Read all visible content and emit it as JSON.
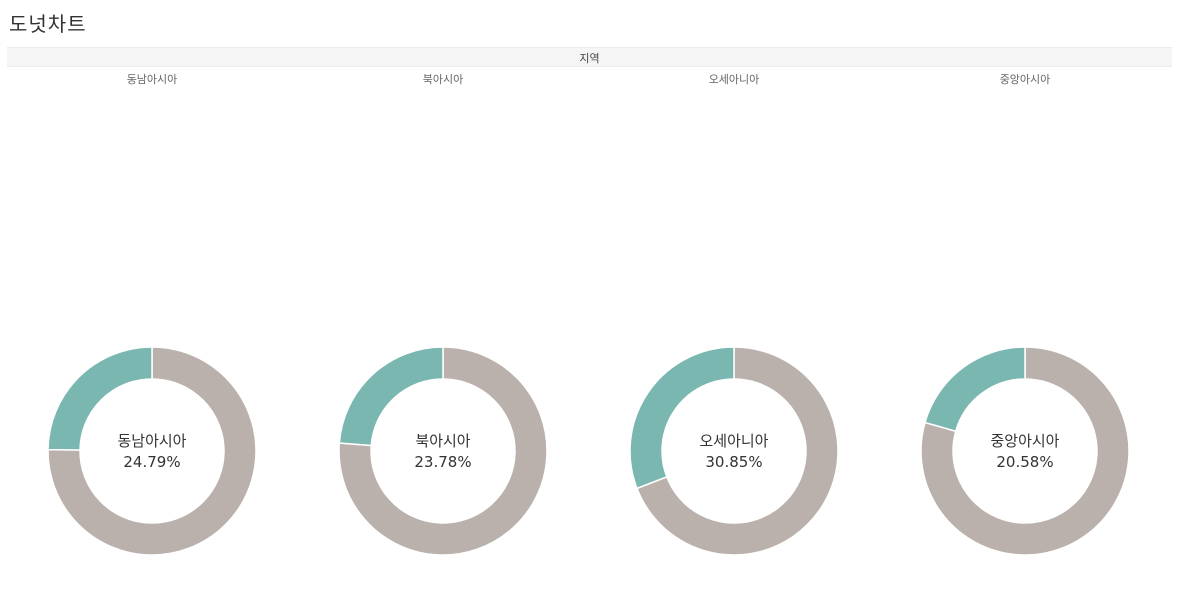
{
  "title": "도넛차트",
  "header": {
    "label": "지역"
  },
  "colors": {
    "share": "#7ab7b1",
    "remainder": "#bab0ac",
    "band": "#f5f5f5"
  },
  "chart_data": {
    "type": "pie",
    "subtype": "donut",
    "facet_label": "지역",
    "categories": [
      "동남아시아",
      "북아시아",
      "오세아니아",
      "중앙아시아"
    ],
    "values": [
      24.79,
      23.78,
      30.85,
      20.58
    ],
    "value_labels": [
      "24.79%",
      "23.78%",
      "30.85%",
      "20.58%"
    ],
    "unit": "%",
    "legend": "none"
  }
}
